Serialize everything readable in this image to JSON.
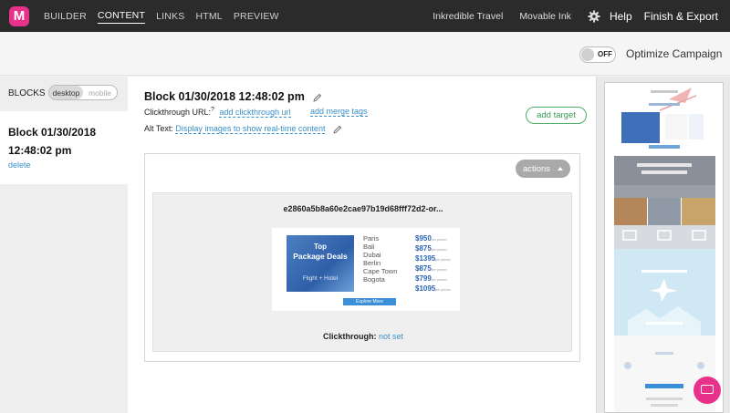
{
  "nav": {
    "logo_letter": "M",
    "tabs": [
      "BUILDER",
      "CONTENT",
      "LINKS",
      "HTML",
      "PREVIEW"
    ],
    "active_tab": "CONTENT",
    "account": "Inkredible Travel",
    "org": "Movable Ink",
    "help": "Help",
    "finish": "Finish & Export"
  },
  "optimize": {
    "toggle_state": "OFF",
    "label": "Optimize Campaign"
  },
  "left": {
    "header": "BLOCKS",
    "view_options": [
      "desktop",
      "mobile"
    ],
    "selected_view": "desktop",
    "block_title": "Block 01/30/2018 12:48:02 pm",
    "delete": "delete"
  },
  "main": {
    "title": "Block 01/30/2018 12:48:02 pm",
    "clickthrough_label": "Clickthrough URL:",
    "clickthrough_help": "?",
    "add_clickthrough": "add clickthrough url",
    "add_merge": "add merge tags",
    "alt_label": "Alt Text:",
    "alt_value": "Display images to show real-time content",
    "add_target": "add target",
    "actions": "actions",
    "image_name": "e2860a5b8a60e2cae97b19d68fff72d2-or...",
    "clickthrough_status_label": "Clickthrough:",
    "clickthrough_status": "not set"
  },
  "thumbnail": {
    "headline_1": "Top",
    "headline_2": "Package Deals",
    "tagline": "Flight + Hotel",
    "cities": [
      "Paris",
      "Bali",
      "Dubai",
      "Berlin",
      "Cape Town",
      "Bogota"
    ],
    "prices": [
      "$950",
      "$875",
      "$1395",
      "$875",
      "$799",
      "$1095"
    ],
    "per_person": "per person",
    "explore": "Explore More"
  },
  "colors": {
    "brand": "#e8318a",
    "link": "#3a8fc9",
    "success": "#4caf66",
    "nav_bg": "#2b2b2b"
  }
}
